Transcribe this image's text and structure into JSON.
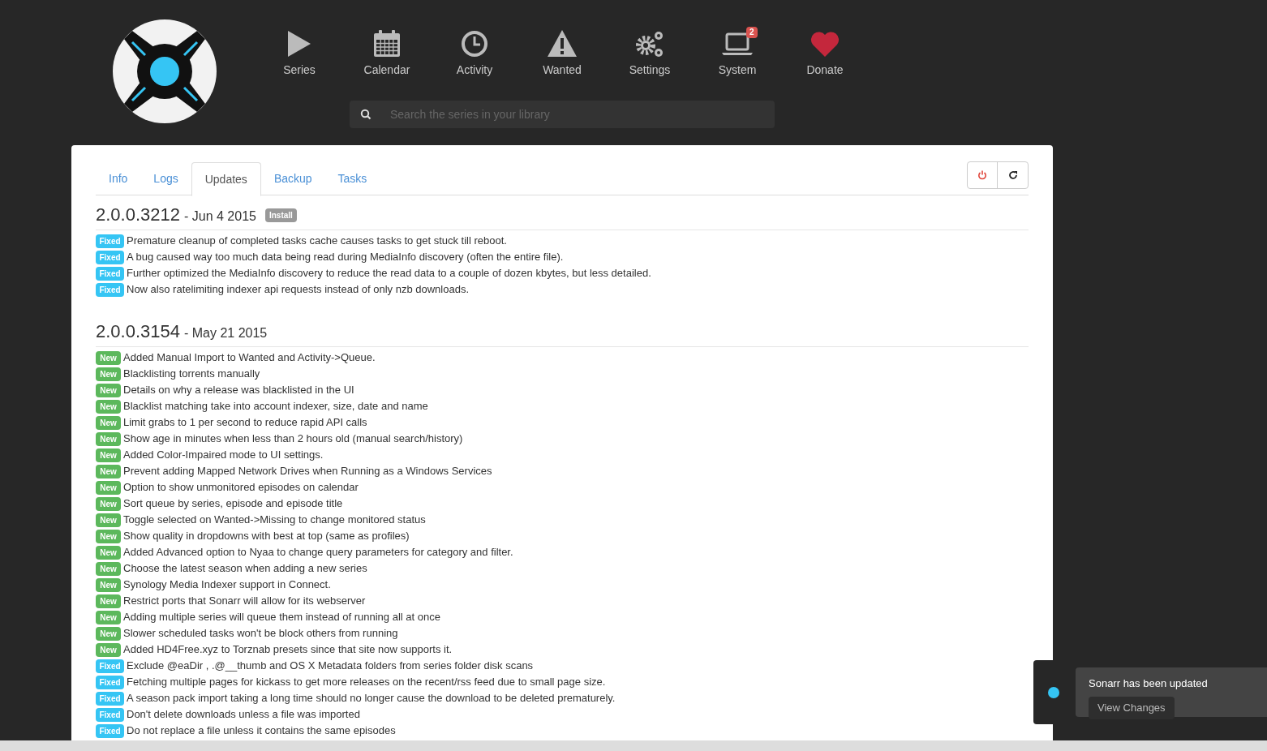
{
  "nav": [
    {
      "label": "Series"
    },
    {
      "label": "Calendar"
    },
    {
      "label": "Activity"
    },
    {
      "label": "Wanted"
    },
    {
      "label": "Settings"
    },
    {
      "label": "System",
      "badge": "2"
    },
    {
      "label": "Donate"
    }
  ],
  "search": {
    "placeholder": "Search the series in your library"
  },
  "tabs": [
    {
      "label": "Info",
      "selected": false
    },
    {
      "label": "Logs",
      "selected": false
    },
    {
      "label": "Updates",
      "selected": true
    },
    {
      "label": "Backup",
      "selected": false
    },
    {
      "label": "Tasks",
      "selected": false
    }
  ],
  "releases": [
    {
      "version": "2.0.0.3212",
      "date": "- Jun 4 2015",
      "install": "Install",
      "changes": [
        {
          "kind": "fixed",
          "label": "Fixed",
          "text": "Premature cleanup of completed tasks cache causes tasks to get stuck till reboot."
        },
        {
          "kind": "fixed",
          "label": "Fixed",
          "text": "A bug caused way too much data being read during MediaInfo discovery (often the entire file)."
        },
        {
          "kind": "fixed",
          "label": "Fixed",
          "text": "Further optimized the MediaInfo discovery to reduce the read data to a couple of dozen kbytes, but less detailed."
        },
        {
          "kind": "fixed",
          "label": "Fixed",
          "text": "Now also ratelimiting indexer api requests instead of only nzb downloads."
        }
      ]
    },
    {
      "version": "2.0.0.3154",
      "date": "- May 21 2015",
      "changes": [
        {
          "kind": "new",
          "label": "New",
          "text": "Added Manual Import to Wanted and Activity->Queue."
        },
        {
          "kind": "new",
          "label": "New",
          "text": "Blacklisting torrents manually"
        },
        {
          "kind": "new",
          "label": "New",
          "text": "Details on why a release was blacklisted in the UI"
        },
        {
          "kind": "new",
          "label": "New",
          "text": "Blacklist matching take into account indexer, size, date and name"
        },
        {
          "kind": "new",
          "label": "New",
          "text": "Limit grabs to 1 per second to reduce rapid API calls"
        },
        {
          "kind": "new",
          "label": "New",
          "text": "Show age in minutes when less than 2 hours old (manual search/history)"
        },
        {
          "kind": "new",
          "label": "New",
          "text": "Added Color-Impaired mode to UI settings."
        },
        {
          "kind": "new",
          "label": "New",
          "text": "Prevent adding Mapped Network Drives when Running as a Windows Services"
        },
        {
          "kind": "new",
          "label": "New",
          "text": "Option to show unmonitored episodes on calendar"
        },
        {
          "kind": "new",
          "label": "New",
          "text": "Sort queue by series, episode and episode title"
        },
        {
          "kind": "new",
          "label": "New",
          "text": "Toggle selected on Wanted->Missing to change monitored status"
        },
        {
          "kind": "new",
          "label": "New",
          "text": "Show quality in dropdowns with best at top (same as profiles)"
        },
        {
          "kind": "new",
          "label": "New",
          "text": "Added Advanced option to Nyaa to change query parameters for category and filter."
        },
        {
          "kind": "new",
          "label": "New",
          "text": "Choose the latest season when adding a new series"
        },
        {
          "kind": "new",
          "label": "New",
          "text": "Synology Media Indexer support in Connect."
        },
        {
          "kind": "new",
          "label": "New",
          "text": "Restrict ports that Sonarr will allow for its webserver"
        },
        {
          "kind": "new",
          "label": "New",
          "text": "Adding multiple series will queue them instead of running all at once"
        },
        {
          "kind": "new",
          "label": "New",
          "text": "Slower scheduled tasks won't be block others from running"
        },
        {
          "kind": "new",
          "label": "New",
          "text": "Added HD4Free.xyz to Torznab presets since that site now supports it."
        },
        {
          "kind": "fixed",
          "label": "Fixed",
          "text": "Exclude @eaDir , .@__thumb and OS X Metadata folders from series folder disk scans"
        },
        {
          "kind": "fixed",
          "label": "Fixed",
          "text": "Fetching multiple pages for kickass to get more releases on the recent/rss feed due to small page size."
        },
        {
          "kind": "fixed",
          "label": "Fixed",
          "text": "A season pack import taking a long time should no longer cause the download to be deleted prematurely."
        },
        {
          "kind": "fixed",
          "label": "Fixed",
          "text": "Don't delete downloads unless a file was imported"
        },
        {
          "kind": "fixed",
          "label": "Fixed",
          "text": "Do not replace a file unless it contains the same episodes"
        }
      ]
    }
  ],
  "toast": {
    "message": "Sonarr has been updated",
    "button": "View Changes"
  }
}
